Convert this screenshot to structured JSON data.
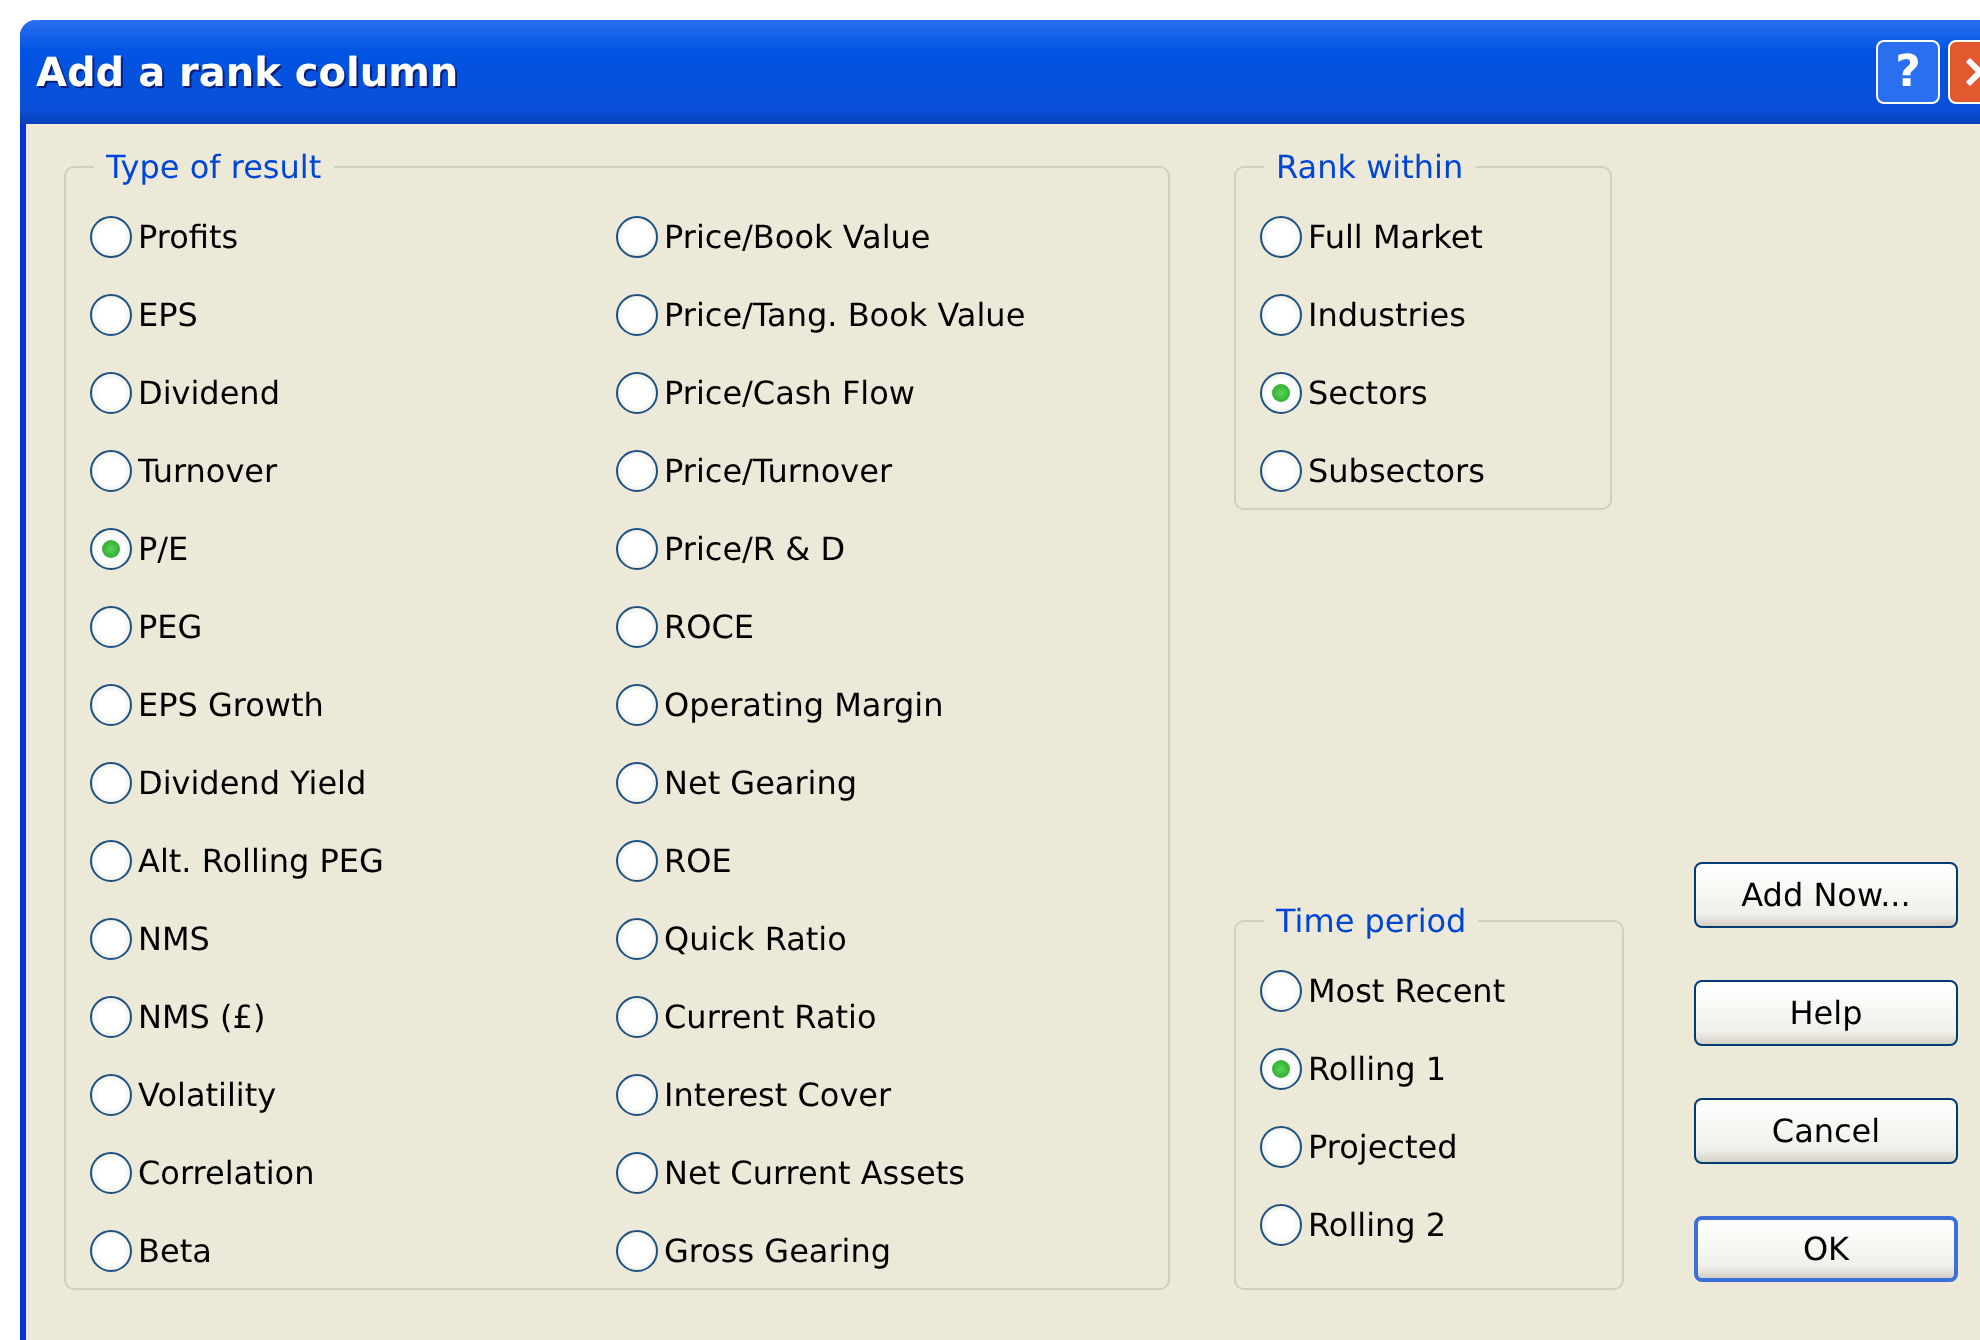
{
  "window": {
    "title": "Add a rank column",
    "help_button": "?"
  },
  "type_of_result": {
    "legend": "Type of result",
    "columns": [
      [
        {
          "label": "Profits",
          "selected": false
        },
        {
          "label": "EPS",
          "selected": false
        },
        {
          "label": "Dividend",
          "selected": false
        },
        {
          "label": "Turnover",
          "selected": false
        },
        {
          "label": "P/E",
          "selected": true
        },
        {
          "label": "PEG",
          "selected": false
        },
        {
          "label": "EPS Growth",
          "selected": false
        },
        {
          "label": "Dividend Yield",
          "selected": false
        },
        {
          "label": "Alt. Rolling PEG",
          "selected": false
        },
        {
          "label": "NMS",
          "selected": false
        },
        {
          "label": "NMS (£)",
          "selected": false
        },
        {
          "label": "Volatility",
          "selected": false
        },
        {
          "label": "Correlation",
          "selected": false
        },
        {
          "label": "Beta",
          "selected": false
        }
      ],
      [
        {
          "label": "Price/Book Value",
          "selected": false
        },
        {
          "label": "Price/Tang. Book Value",
          "selected": false
        },
        {
          "label": "Price/Cash Flow",
          "selected": false
        },
        {
          "label": "Price/Turnover",
          "selected": false
        },
        {
          "label": "Price/R & D",
          "selected": false
        },
        {
          "label": "ROCE",
          "selected": false
        },
        {
          "label": "Operating Margin",
          "selected": false
        },
        {
          "label": "Net Gearing",
          "selected": false
        },
        {
          "label": "ROE",
          "selected": false
        },
        {
          "label": "Quick Ratio",
          "selected": false
        },
        {
          "label": "Current Ratio",
          "selected": false
        },
        {
          "label": "Interest Cover",
          "selected": false
        },
        {
          "label": "Net Current Assets",
          "selected": false
        },
        {
          "label": "Gross Gearing",
          "selected": false
        }
      ]
    ]
  },
  "rank_within": {
    "legend": "Rank within",
    "options": [
      {
        "label": "Full Market",
        "selected": false
      },
      {
        "label": "Industries",
        "selected": false
      },
      {
        "label": "Sectors",
        "selected": true
      },
      {
        "label": "Subsectors",
        "selected": false
      }
    ]
  },
  "time_period": {
    "legend": "Time period",
    "options": [
      {
        "label": "Most Recent",
        "selected": false
      },
      {
        "label": "Rolling 1",
        "selected": true
      },
      {
        "label": "Projected",
        "selected": false
      },
      {
        "label": "Rolling 2",
        "selected": false
      }
    ]
  },
  "buttons": [
    {
      "label": "Add Now...",
      "default": false
    },
    {
      "label": "Help",
      "default": false
    },
    {
      "label": "Cancel",
      "default": false
    },
    {
      "label": "OK",
      "default": true
    }
  ]
}
